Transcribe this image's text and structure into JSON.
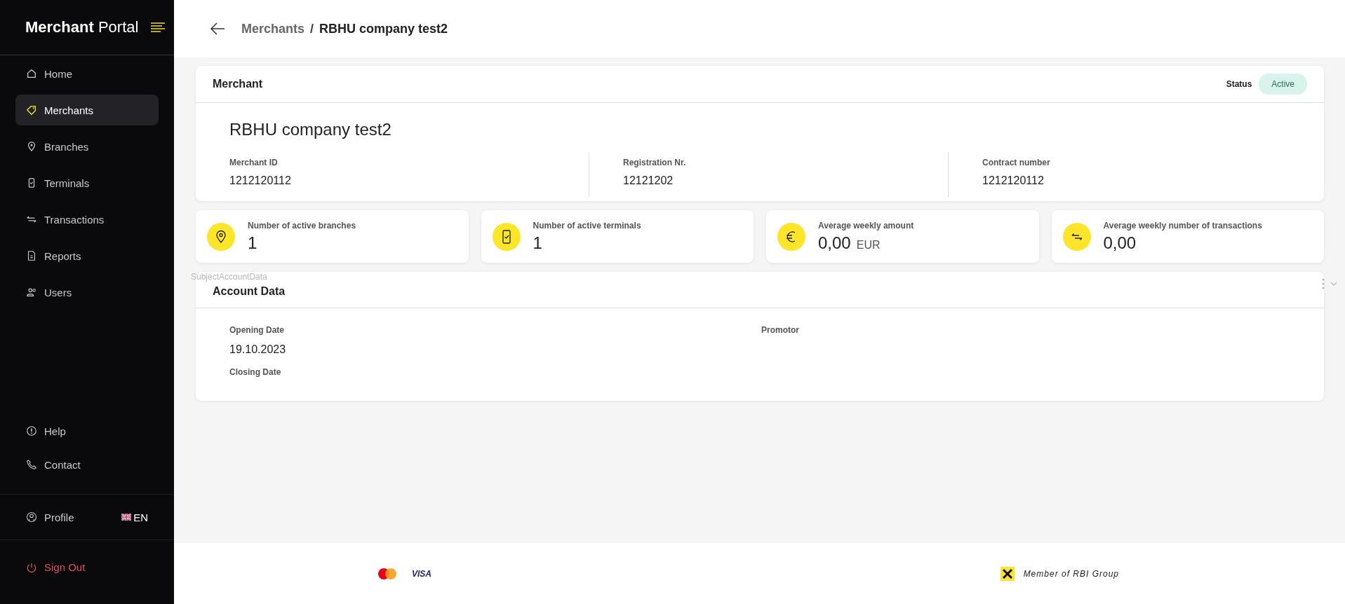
{
  "sidebar": {
    "brand": {
      "bold": "Merchant",
      "light": "Portal"
    },
    "nav_items": [
      {
        "label": "Home",
        "selected": false
      },
      {
        "label": "Merchants",
        "selected": true
      },
      {
        "label": "Branches",
        "selected": false
      },
      {
        "label": "Terminals",
        "selected": false
      },
      {
        "label": "Transactions",
        "selected": false
      },
      {
        "label": "Reports",
        "selected": false
      },
      {
        "label": "Users",
        "selected": false
      }
    ],
    "bottom_items": [
      {
        "label": "Help"
      },
      {
        "label": "Contact"
      }
    ],
    "profile": {
      "label": "Profile",
      "language": "EN"
    },
    "sign_out": "Sign Out"
  },
  "header": {
    "breadcrumb_parent": "Merchants",
    "separator": "/",
    "breadcrumb_current": "RBHU company test2"
  },
  "merchant_card": {
    "title": "Merchant",
    "status_label": "Status",
    "status": "Active",
    "name": "RBHU company test2",
    "fields": [
      {
        "label": "Merchant ID",
        "value": "1212120112"
      },
      {
        "label": "Registration Nr.",
        "value": "12121202"
      },
      {
        "label": "Contract number",
        "value": "1212120112"
      }
    ]
  },
  "stats": [
    {
      "label": "Number of active branches",
      "value": "1"
    },
    {
      "label": "Number of active terminals",
      "value": "1"
    },
    {
      "label": "Average weekly amount",
      "value": "0,00",
      "unit": "EUR"
    },
    {
      "label": "Average weekly number of transactions",
      "value": "0,00"
    }
  ],
  "account_card": {
    "ghost_label": "SubjectAccountData",
    "title": "Account Data",
    "fields": [
      {
        "label": "Opening Date",
        "value": "19.10.2023"
      },
      {
        "label": "Promotor"
      },
      {
        "label": "Closing Date"
      }
    ]
  },
  "footer": {
    "card_brand": "VISA",
    "group_text": "Member of RBI Group"
  }
}
